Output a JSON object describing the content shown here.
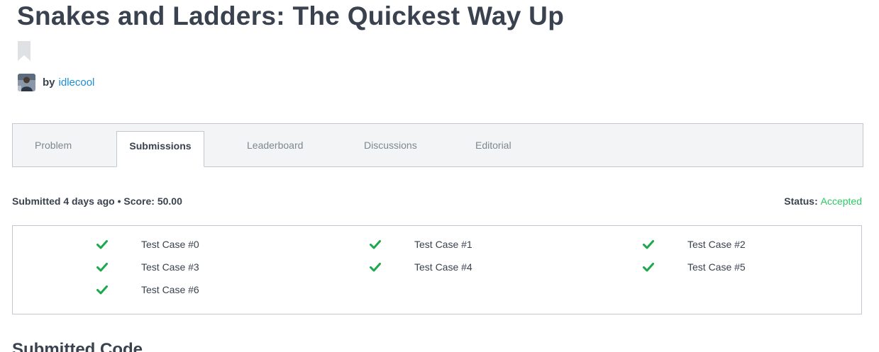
{
  "challenge": {
    "title": "Snakes and Ladders: The Quickest Way Up",
    "by_label": "by",
    "author": "idlecool"
  },
  "tabs": [
    {
      "label": "Problem"
    },
    {
      "label": "Submissions",
      "active": true
    },
    {
      "label": "Leaderboard"
    },
    {
      "label": "Discussions"
    },
    {
      "label": "Editorial"
    }
  ],
  "submission": {
    "summary": "Submitted 4 days ago • Score: 50.00",
    "status_label": "Status:",
    "status_value": "Accepted"
  },
  "test_cases": [
    {
      "label": "Test Case #0",
      "passed": true
    },
    {
      "label": "Test Case #1",
      "passed": true
    },
    {
      "label": "Test Case #2",
      "passed": true
    },
    {
      "label": "Test Case #3",
      "passed": true
    },
    {
      "label": "Test Case #4",
      "passed": true
    },
    {
      "label": "Test Case #5",
      "passed": true
    },
    {
      "label": "Test Case #6",
      "passed": true
    }
  ],
  "section_heading": "Submitted Code",
  "colors": {
    "text": "#39424e",
    "link": "#1a8fd8",
    "accepted": "#2ec866",
    "check": "#1ba94c",
    "border": "#c2c7d0",
    "tab_bg": "#f3f4f5"
  },
  "icons": {
    "bookmark": "bookmark-icon",
    "check": "check-icon",
    "avatar": "avatar"
  }
}
